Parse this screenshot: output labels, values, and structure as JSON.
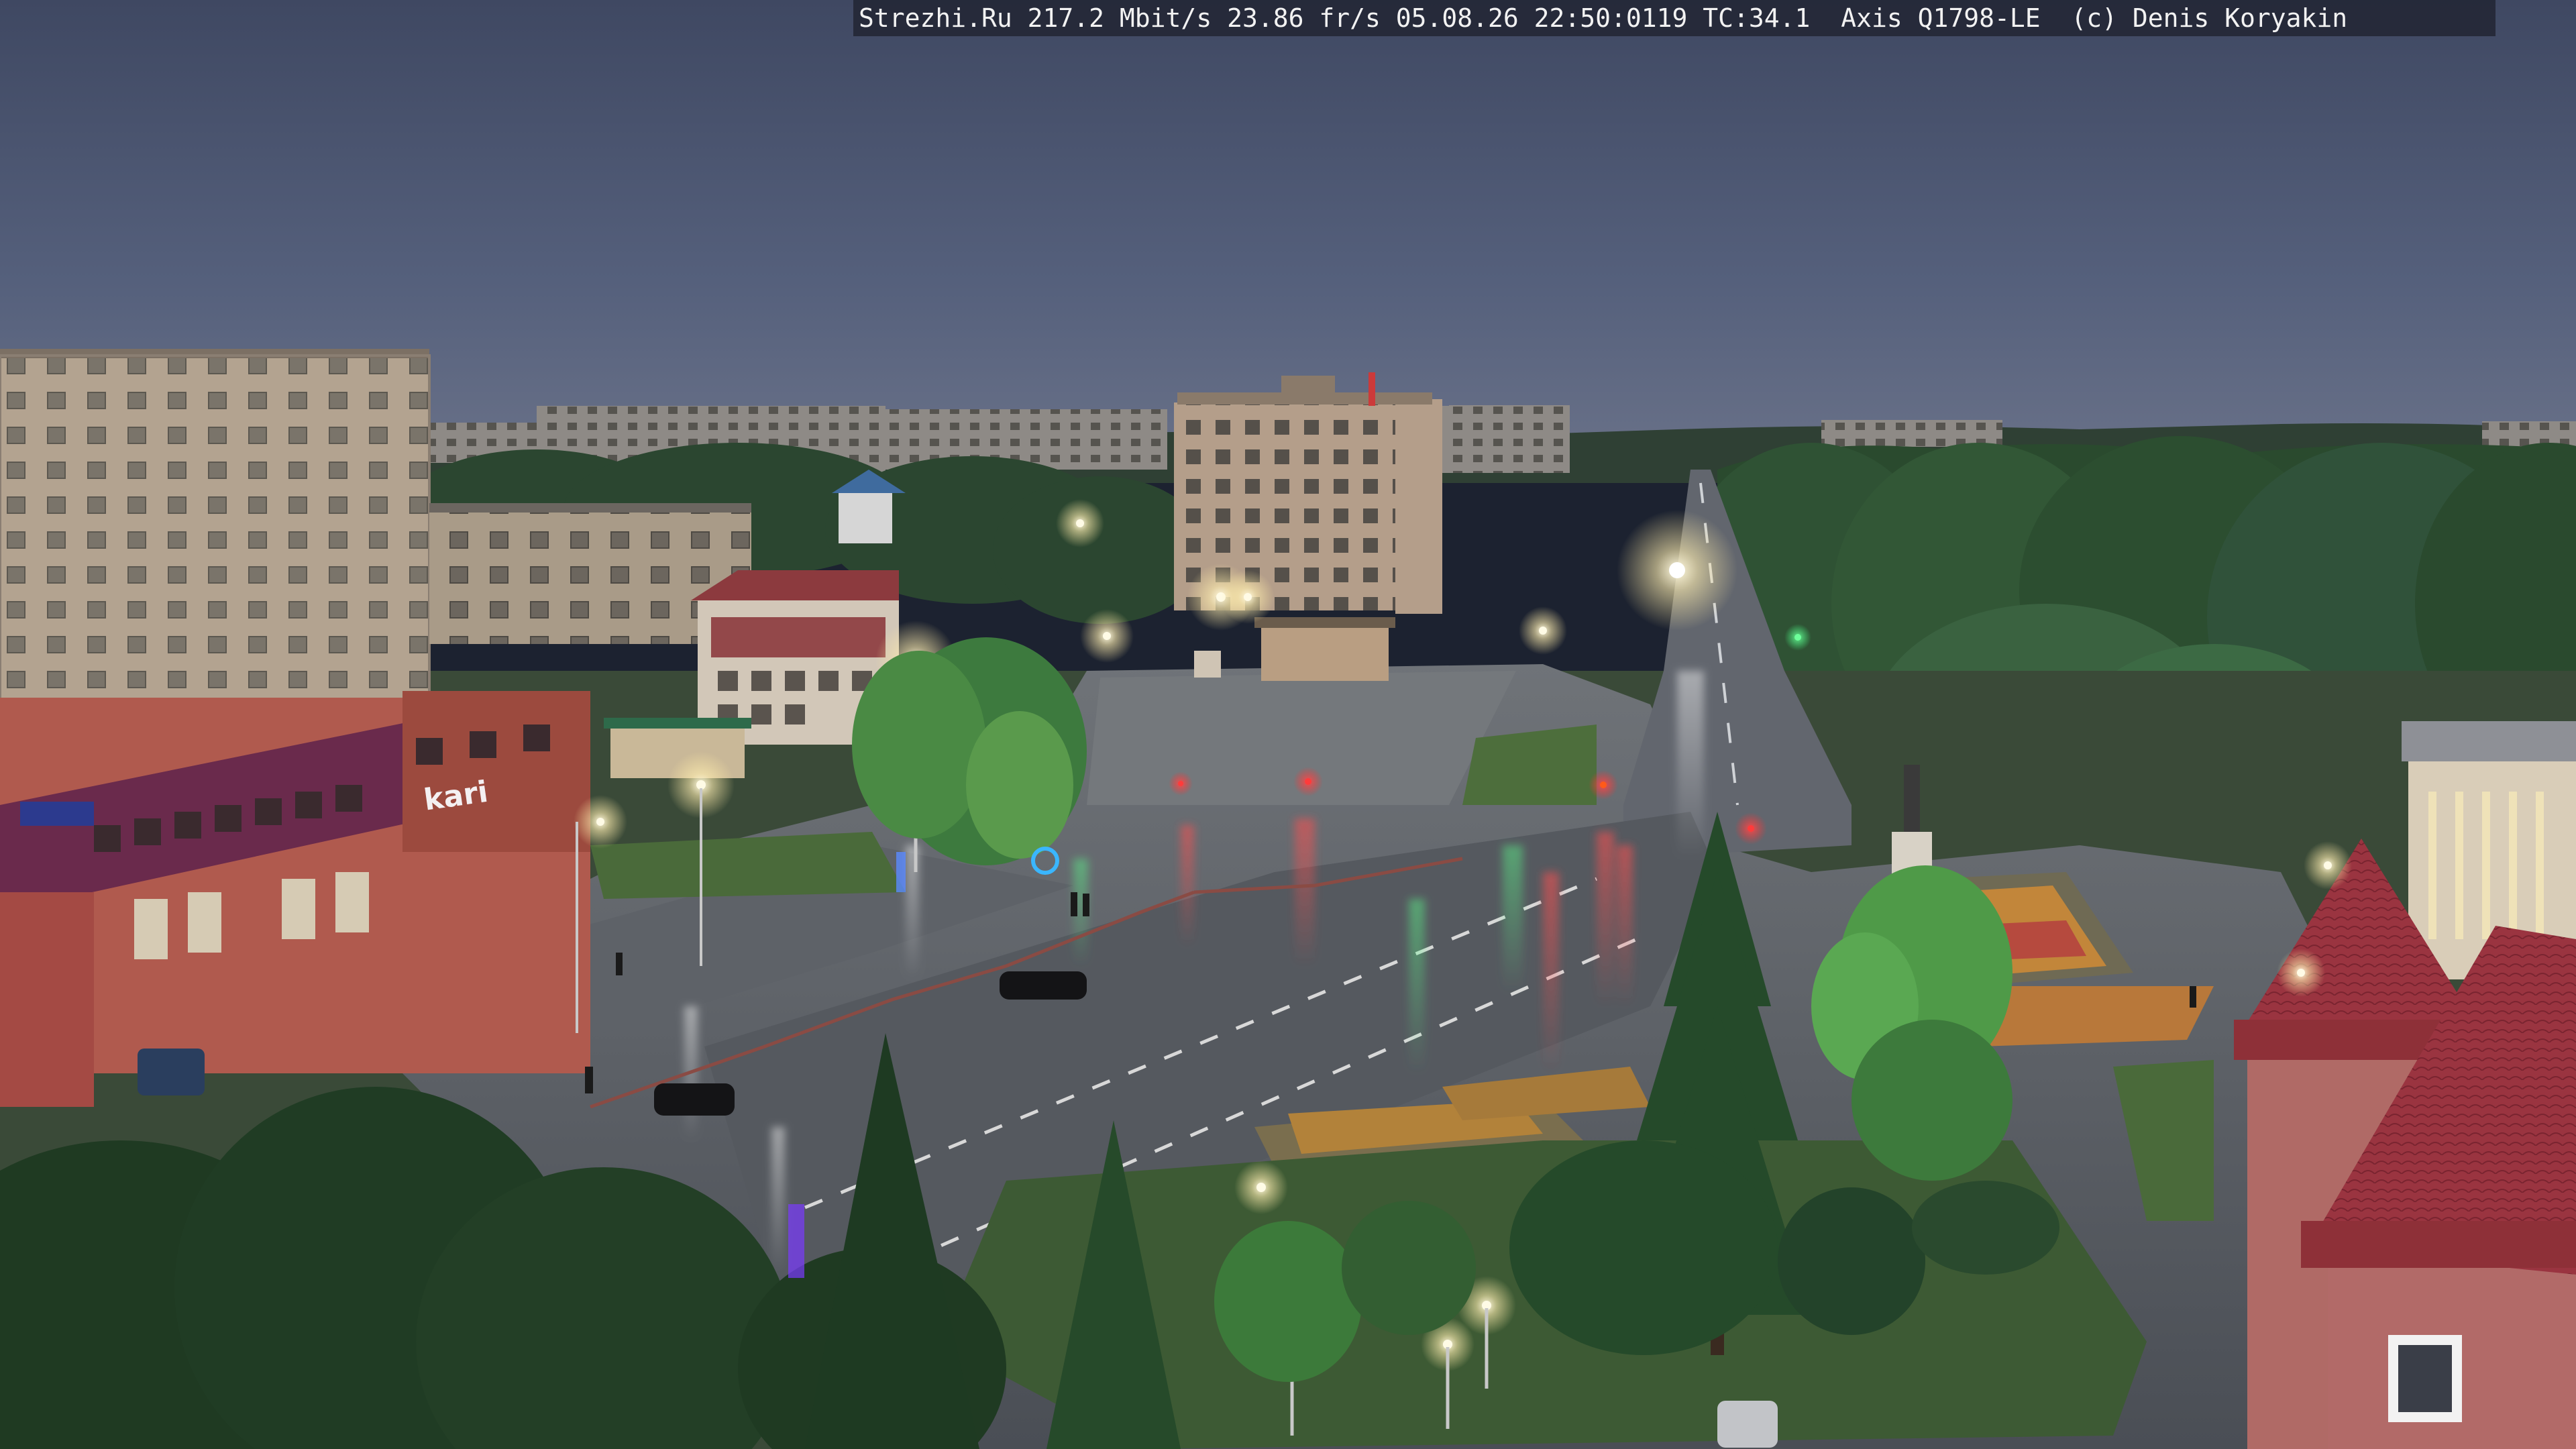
{
  "camera_overlay": {
    "text": "Strezhi.Ru 217.2 Mbit/s 23.86 fr/s 05.08.26 22:50:0119 TC:34.1  Axis Q1798-LE  (c) Denis Koryakin"
  },
  "signage": {
    "store_sign": "kari"
  },
  "scene": {
    "sky_color": "#4c5672",
    "tree_color": "#2a4a2e",
    "road_color": "#5a5e66",
    "building_light_color": "#b3a390",
    "building_red_color": "#8c3a3e",
    "lamp_color": "#fff6d8"
  }
}
